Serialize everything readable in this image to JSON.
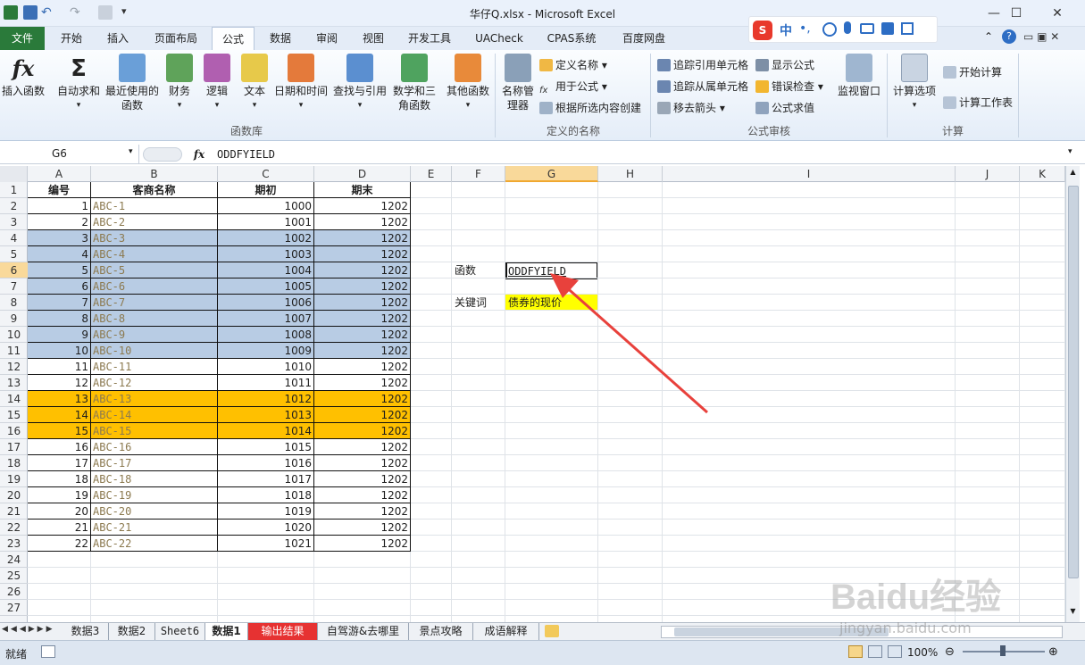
{
  "title": "华仔Q.xlsx  -  Microsoft Excel",
  "window_controls": {
    "minimize": "—",
    "maximize": "☐",
    "close": "✕"
  },
  "ime": {
    "mode_label": "中",
    "punct": "•,"
  },
  "tabs": [
    "开始",
    "插入",
    "页面布局",
    "公式",
    "数据",
    "审阅",
    "视图",
    "开发工具",
    "UACheck",
    "CPAS系统",
    "百度网盘"
  ],
  "file_tab": "文件",
  "active_tab": "公式",
  "ribbon": {
    "function_library": {
      "group": "函数库",
      "buttons": [
        "插入函数",
        "自动求和",
        "最近使用的函数",
        "财务",
        "逻辑",
        "文本",
        "日期和时间",
        "查找与引用",
        "数学和三角函数",
        "其他函数"
      ]
    },
    "defined_names": {
      "group": "定义的名称",
      "big": "名称管理器",
      "small": [
        "定义名称",
        "用于公式",
        "根据所选内容创建"
      ]
    },
    "formula_auditing": {
      "group": "公式审核",
      "small": [
        "追踪引用单元格",
        "追踪从属单元格",
        "移去箭头",
        "显示公式",
        "错误检查",
        "公式求值"
      ],
      "big": "监视窗口"
    },
    "calculation": {
      "group": "计算",
      "big": "计算选项",
      "small": [
        "开始计算",
        "计算工作表"
      ]
    }
  },
  "formula_bar": {
    "name_box": "G6",
    "fx": "fx",
    "formula": "ODDFYIELD"
  },
  "columns": [
    "A",
    "B",
    "C",
    "D",
    "E",
    "F",
    "G",
    "H",
    "I",
    "J",
    "K"
  ],
  "rows": [
    "1",
    "2",
    "3",
    "4",
    "5",
    "6",
    "7",
    "8",
    "9",
    "10",
    "11",
    "12",
    "13",
    "14",
    "15",
    "16",
    "17",
    "18",
    "19",
    "20",
    "21",
    "22",
    "23",
    "24",
    "25",
    "26",
    "27"
  ],
  "table": {
    "headers": [
      "编号",
      "客商名称",
      "期初",
      "期末"
    ],
    "data": [
      [
        "1",
        "ABC-1",
        "1000",
        "1202"
      ],
      [
        "2",
        "ABC-2",
        "1001",
        "1202"
      ],
      [
        "3",
        "ABC-3",
        "1002",
        "1202"
      ],
      [
        "4",
        "ABC-4",
        "1003",
        "1202"
      ],
      [
        "5",
        "ABC-5",
        "1004",
        "1202"
      ],
      [
        "6",
        "ABC-6",
        "1005",
        "1202"
      ],
      [
        "7",
        "ABC-7",
        "1006",
        "1202"
      ],
      [
        "8",
        "ABC-8",
        "1007",
        "1202"
      ],
      [
        "9",
        "ABC-9",
        "1008",
        "1202"
      ],
      [
        "10",
        "ABC-10",
        "1009",
        "1202"
      ],
      [
        "11",
        "ABC-11",
        "1010",
        "1202"
      ],
      [
        "12",
        "ABC-12",
        "1011",
        "1202"
      ],
      [
        "13",
        "ABC-13",
        "1012",
        "1202"
      ],
      [
        "14",
        "ABC-14",
        "1013",
        "1202"
      ],
      [
        "15",
        "ABC-15",
        "1014",
        "1202"
      ],
      [
        "16",
        "ABC-16",
        "1015",
        "1202"
      ],
      [
        "17",
        "ABC-17",
        "1016",
        "1202"
      ],
      [
        "18",
        "ABC-18",
        "1017",
        "1202"
      ],
      [
        "19",
        "ABC-19",
        "1018",
        "1202"
      ],
      [
        "20",
        "ABC-20",
        "1019",
        "1202"
      ],
      [
        "21",
        "ABC-21",
        "1020",
        "1202"
      ],
      [
        "22",
        "ABC-22",
        "1021",
        "1202"
      ]
    ],
    "row_fill": [
      "none",
      "none",
      "blue",
      "blue",
      "blue",
      "blue",
      "blue",
      "blue",
      "blue",
      "blue",
      "none",
      "none",
      "orange",
      "orange",
      "orange",
      "none",
      "none",
      "none",
      "none",
      "none",
      "none",
      "none"
    ]
  },
  "side": {
    "label1": "函数",
    "value1": "ODDFYIELD",
    "label2": "关键词",
    "value2": "债券的现价"
  },
  "sheet_tabs": [
    "数据3",
    "数据2",
    "Sheet6",
    "数据1",
    "输出结果",
    "自驾游&去哪里",
    "景点攻略",
    "成语解释"
  ],
  "active_sheet": "数据1",
  "status": {
    "ready": "就绪",
    "zoom": "100%"
  },
  "watermark": {
    "brand": "Baidu经验",
    "url": "jingyan.baidu.com"
  },
  "colors": {
    "blue_fill": "#b8cce4",
    "orange_fill": "#ffc000",
    "yellow_fill": "#ffff00",
    "arrow": "#e8413c",
    "file_tab": "#2a7a3a"
  }
}
